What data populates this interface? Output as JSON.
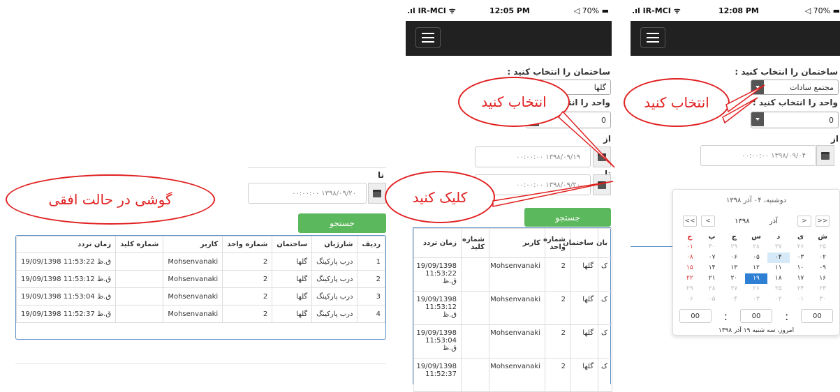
{
  "annotations": {
    "landscape": "گوشی در حالت افقی",
    "select1": "انتخاب کنید",
    "select2": "انتخاب کنید",
    "click": "کلیک کنید"
  },
  "landscape": {
    "to_label": "تا",
    "to_date": "۰۰:۰۰:۰۰ ۱۳۹۸/۰۹/۲۰",
    "search_label": "جستجو",
    "headers": [
      "ردیف",
      "شارژبان",
      "ساختمان",
      "شماره واحد",
      "کاربر",
      "شماره کلید",
      "زمان تردد"
    ],
    "rows": [
      [
        "1",
        "درب پارکینگ",
        "گلها",
        "2",
        "Mohsenvanaki",
        "",
        "ق.ظ 11:53:22 19/09/1398"
      ],
      [
        "2",
        "درب پارکینگ",
        "گلها",
        "2",
        "Mohsenvanaki",
        "",
        "ق.ظ 11:53:12 19/09/1398"
      ],
      [
        "3",
        "درب پارکینگ",
        "گلها",
        "2",
        "Mohsenvanaki",
        "",
        "ق.ظ 11:53:04 19/09/1398"
      ],
      [
        "4",
        "درب پارکینگ",
        "گلها",
        "2",
        "Mohsenvanaki",
        "",
        "ق.ظ 11:52:37 19/09/1398"
      ]
    ]
  },
  "phone1": {
    "carrier": "IR-MCI",
    "time": "12:05 PM",
    "battery": "70%",
    "building_label": "ساختمان را انتخاب کنید :",
    "building_value": "گلها",
    "unit_label": "واحد را انتخاب کنید :",
    "unit_value": "0",
    "from_label": "از",
    "from_date": "۰۰:۰۰:۰۰ ۱۳۹۸/۰۹/۱۹",
    "to_label": "تا",
    "to_date": "۰۰:۰۰:۰۰ ۱۳۹۸/۰۹/۲۰",
    "search_label": "جستجو",
    "headers": [
      "بان",
      "ساختمان",
      "شماره واحد",
      "کاربر",
      "شماره کلید",
      "زمان تردد"
    ],
    "rows": [
      [
        "ک",
        "گلها",
        "2",
        "Mohsenvanaki",
        "",
        "19/09/1398 11:53:22 ق.ظ"
      ],
      [
        "ک",
        "گلها",
        "2",
        "Mohsenvanaki",
        "",
        "19/09/1398 11:53:12 ق.ظ"
      ],
      [
        "ک",
        "گلها",
        "2",
        "Mohsenvanaki",
        "",
        "19/09/1398 11:53:04 ق.ظ"
      ],
      [
        "ک",
        "گلها",
        "2",
        "Mohsenvanaki",
        "",
        "19/09/1398 11:52:37"
      ]
    ]
  },
  "phone2": {
    "carrier": "IR-MCI",
    "time": "12:08 PM",
    "battery": "70%",
    "building_label": "ساختمان را انتخاب کنید :",
    "building_value": "مجتمع سادات",
    "unit_label": "واحد را انتخاب کنید :",
    "unit_value": "0",
    "from_label": "از",
    "from_date": "۰۰:۰۰:۰۰ ۱۳۹۸/۰۹/۰۴",
    "calendar": {
      "header": "دوشنبه، ۰۴ آذر ۱۳۹۸",
      "year": "۱۳۹۸",
      "month": "آذر",
      "nav": [
        "<<",
        "<",
        ">",
        ">>"
      ],
      "weekdays": [
        "ش",
        "ی",
        "د",
        "س",
        "چ",
        "پ",
        "ج"
      ],
      "weeks": [
        [
          "۲۵",
          "۲۶",
          "۲۷",
          "۲۸",
          "۲۹",
          "۳۰",
          "۰۱"
        ],
        [
          "۰۲",
          "۰۳",
          "۰۴",
          "۰۵",
          "۰۶",
          "۰۷",
          "۰۸"
        ],
        [
          "۰۹",
          "۱۰",
          "۱۱",
          "۱۲",
          "۱۳",
          "۱۴",
          "۱۵"
        ],
        [
          "۱۶",
          "۱۷",
          "۱۸",
          "۱۹",
          "۲۰",
          "۲۱",
          "۲۲"
        ],
        [
          "۲۳",
          "۲۴",
          "۲۵",
          "۲۶",
          "۲۷",
          "۲۸",
          "۲۹"
        ],
        [
          "۳۰",
          "۰۱",
          "۰۲",
          "۰۳",
          "۰۴",
          "۰۵",
          "۰۶"
        ]
      ],
      "time_h": "00",
      "time_m": "00",
      "time_s": "00",
      "footer": "امروز، سه شنبه ۱۹ آذر ۱۳۹۸"
    }
  }
}
